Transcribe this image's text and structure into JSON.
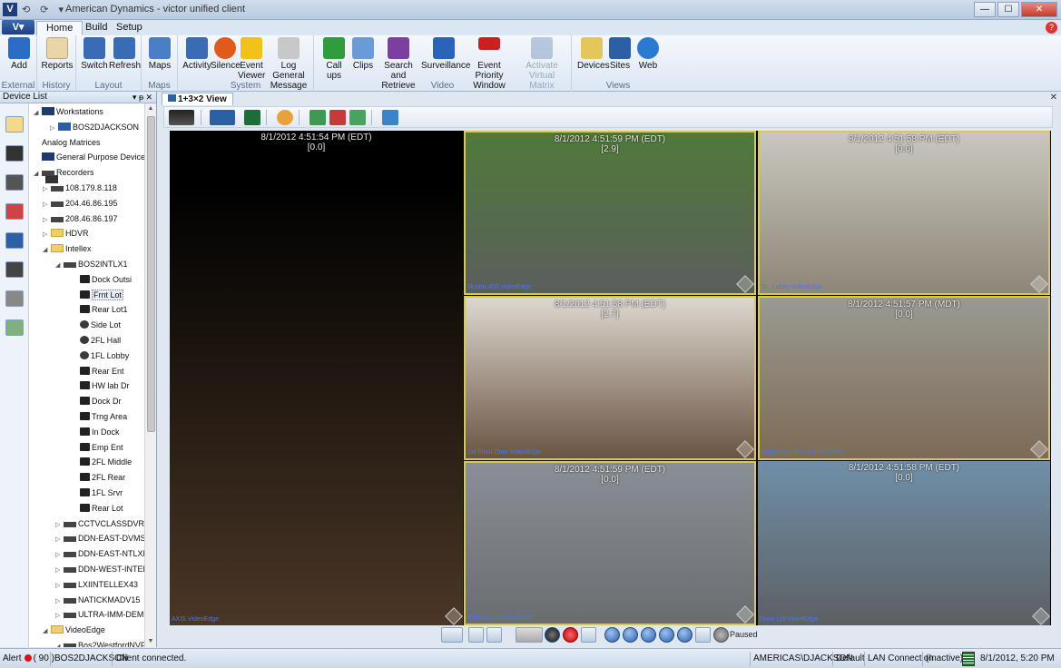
{
  "window": {
    "app_icon": "V",
    "title": "American Dynamics - victor unified client",
    "buttons": {
      "minimize": "—",
      "maximize": "☐",
      "close": "✕"
    }
  },
  "ribbon_tabs": [
    "Home",
    "Build",
    "Setup"
  ],
  "ribbon": {
    "groups": [
      {
        "label": "External",
        "items": [
          {
            "label": "Add",
            "icon": "add-icon"
          }
        ]
      },
      {
        "label": "History",
        "items": [
          {
            "label": "Reports",
            "icon": "reports-icon"
          }
        ]
      },
      {
        "label": "Layout",
        "items": [
          {
            "label": "Switch",
            "icon": "switch-icon"
          },
          {
            "label": "Refresh",
            "icon": "refresh-icon"
          }
        ]
      },
      {
        "label": "Maps",
        "items": [
          {
            "label": "Maps",
            "icon": "maps-icon"
          }
        ]
      },
      {
        "label": "System",
        "items": [
          {
            "label": "Activity",
            "icon": "activity-icon"
          },
          {
            "label": "Silence",
            "icon": "silence-icon"
          },
          {
            "label": "Event Viewer",
            "icon": "event-viewer-icon"
          },
          {
            "label": "Log General Message",
            "icon": "log-message-icon"
          }
        ]
      },
      {
        "label": "Video",
        "items": [
          {
            "label": "Call ups",
            "icon": "callups-icon"
          },
          {
            "label": "Clips",
            "icon": "clips-icon"
          },
          {
            "label": "Search and Retrieve",
            "icon": "search-retrieve-icon"
          },
          {
            "label": "Surveillance",
            "icon": "surveillance-icon"
          },
          {
            "label": "Event Priority Window",
            "icon": "event-priority-icon"
          },
          {
            "label": "Activate Virtual Matrix",
            "icon": "virtual-matrix-icon"
          }
        ]
      },
      {
        "label": "Views",
        "items": [
          {
            "label": "Devices",
            "icon": "devices-icon"
          },
          {
            "label": "Sites",
            "icon": "sites-icon"
          },
          {
            "label": "Web",
            "icon": "web-icon"
          }
        ]
      }
    ],
    "colors": {
      "add": "#2b6cc4",
      "reports": "#e8d6a8",
      "switch": "#3a6bb5",
      "refresh": "#3a6bb5",
      "maps": "#4a7fc8",
      "activity": "#3a6bb5",
      "silence": "#e05a1c",
      "event_viewer": "#f3c21a",
      "log_message": "#c8c8c8",
      "callups": "#2f9d3e",
      "clips": "#6b9bd6",
      "search": "#7a3fa0",
      "surveillance": "#2a63b8",
      "event_priority": "#cc1f1f",
      "virtual_matrix": "#6f8fb8",
      "devices": "#e4c65a",
      "sites": "#2d5fa5",
      "web": "#2b7ad1"
    }
  },
  "device_list": {
    "title": "Device List",
    "pin_glyph": "▾ ᵽ ✕",
    "tree": [
      {
        "label": "Workstations",
        "icon": "ws",
        "expander": "◢"
      },
      {
        "label": "BOS2DJACKSON",
        "icon": "mon",
        "expander": "▷"
      },
      {
        "label": "Analog Matrices",
        "icon": "grid",
        "expander": ""
      },
      {
        "label": "General Purpose Devices",
        "icon": "ws",
        "expander": ""
      },
      {
        "label": "Recorders",
        "icon": "rec",
        "expander": "◢"
      },
      {
        "label": "108.179.8.118",
        "icon": "rec",
        "expander": "▷"
      },
      {
        "label": "204.46.86.195",
        "icon": "rec",
        "expander": "▷"
      },
      {
        "label": "208.46.86.197",
        "icon": "rec",
        "expander": "▷"
      },
      {
        "label": "HDVR",
        "icon": "fold",
        "expander": "▷"
      },
      {
        "label": "Intellex",
        "icon": "fold",
        "expander": "◢"
      },
      {
        "label": "BOS2INTLX1",
        "icon": "rec",
        "expander": "◢"
      },
      {
        "label": "Dock Outsi",
        "icon": "cam",
        "expander": ""
      },
      {
        "label": "Frnt Lot",
        "icon": "cam",
        "expander": "",
        "selected": true
      },
      {
        "label": "Rear Lot1",
        "icon": "cam",
        "expander": ""
      },
      {
        "label": "Side Lot",
        "icon": "dome",
        "expander": ""
      },
      {
        "label": "2FL Hall",
        "icon": "dome",
        "expander": ""
      },
      {
        "label": "1FL Lobby",
        "icon": "dome",
        "expander": ""
      },
      {
        "label": "Rear Ent",
        "icon": "cam",
        "expander": ""
      },
      {
        "label": "HW lab Dr",
        "icon": "cam",
        "expander": ""
      },
      {
        "label": "Dock Dr",
        "icon": "cam",
        "expander": ""
      },
      {
        "label": "Trng Area",
        "icon": "cam",
        "expander": ""
      },
      {
        "label": "In Dock",
        "icon": "cam",
        "expander": ""
      },
      {
        "label": "Emp Ent",
        "icon": "cam",
        "expander": ""
      },
      {
        "label": "2FL Middle",
        "icon": "cam",
        "expander": ""
      },
      {
        "label": "2FL Rear",
        "icon": "cam",
        "expander": ""
      },
      {
        "label": "1FL Srvr",
        "icon": "cam",
        "expander": ""
      },
      {
        "label": "Rear Lot",
        "icon": "cam",
        "expander": ""
      },
      {
        "label": "CCTVCLASSDVR",
        "icon": "rec",
        "expander": "▷"
      },
      {
        "label": "DDN-EAST-DVMS",
        "icon": "rec",
        "expander": "▷"
      },
      {
        "label": "DDN-EAST-NTLXL",
        "icon": "rec",
        "expander": "▷"
      },
      {
        "label": "DDN-WEST-INTEL",
        "icon": "rec",
        "expander": "▷"
      },
      {
        "label": "LXIINTELLEX43",
        "icon": "rec",
        "expander": "▷"
      },
      {
        "label": "NATICKMADV15",
        "icon": "rec",
        "expander": "▷"
      },
      {
        "label": "ULTRA-IMM-DEM",
        "icon": "rec",
        "expander": "▷"
      },
      {
        "label": "VideoEdge",
        "icon": "fold",
        "expander": "◢"
      },
      {
        "label": "Bos2WestfordNVF",
        "icon": "rec",
        "expander": "◢"
      }
    ],
    "scroll": {
      "up": "▲",
      "down": "▼"
    }
  },
  "view_tab": {
    "label": "1+3×2 View",
    "close": "✕"
  },
  "panes": [
    {
      "timestamp": "8/1/2012 4:51:54 PM (EDT)",
      "frame": "[0.0]",
      "caption": "AXIS VideoEdge",
      "border": "none",
      "sky": "#000000",
      "ground": "#4a3626"
    },
    {
      "timestamp": "8/1/2012 4:51:59 PM (EDT)",
      "frame": "[2.9]",
      "caption": "Illustra 400 VideoEdge",
      "border": "yellow",
      "sky": "#4f7a3a",
      "ground": "#5b5e5d"
    },
    {
      "timestamp": "8/1/2012 4:51:58 PM (EDT)",
      "frame": "[0.0]",
      "caption": "1L_Lobby VideoEdge",
      "border": "yellow",
      "sky": "#c9c7bf",
      "ground": "#8e8678"
    },
    {
      "timestamp": "8/1/2012 4:51:58 PM (EDT)",
      "frame": "[2.7]",
      "caption": "1st Front Door VideoEdge",
      "border": "yellow",
      "sky": "#dcd8cf",
      "ground": "#6b5442"
    },
    {
      "timestamp": "8/1/2012 4:51:57 PM (MDT)",
      "frame": "[0.0]",
      "caption": "Front Door Bos-WESTFORD",
      "border": "yellow",
      "sky": "#9a9a92",
      "ground": "#7d6b55"
    },
    {
      "timestamp": "8/1/2012 4:51:59 PM (EDT)",
      "frame": "[0.0]",
      "caption": "Parking Lot VideoEdge",
      "border": "yellow",
      "sky": "#8a8f96",
      "ground": "#6a6d70"
    },
    {
      "timestamp": "8/1/2012 4:51:58 PM (EDT)",
      "frame": "[0.0]",
      "caption": "Front Lot VideoEdge",
      "border": "none",
      "sky": "#6f8fa8",
      "ground": "#5c6063"
    }
  ],
  "playback": {
    "status": "Paused"
  },
  "status_bar": {
    "alert_label": "Alert",
    "alert_count": "( 90 )",
    "workstation": "BOS2DJACKSON",
    "message": "Client connected.",
    "user": "AMERICAS\\DJACKSON",
    "profile": "Default",
    "connection": "LAN Connection",
    "state": "(Inactive)",
    "clock": "8/1/2012, 5:20 PM"
  }
}
